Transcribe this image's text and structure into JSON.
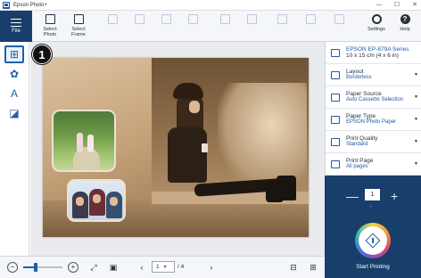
{
  "window": {
    "title": "Epson Photo+",
    "controls": [
      "—",
      "☐",
      "✕"
    ]
  },
  "toolbar": {
    "file_label": "File",
    "buttons": [
      {
        "label": "Select\nPhoto",
        "icon": "select-photo-icon",
        "enabled": true
      },
      {
        "label": "Select\nFrame",
        "icon": "select-frame-icon",
        "enabled": true
      },
      {
        "label": "",
        "icon": "crop-icon",
        "enabled": false
      },
      {
        "label": "",
        "icon": "fit-icon",
        "enabled": false
      },
      {
        "label": "",
        "icon": "rotate-icon",
        "enabled": false
      },
      {
        "label": "",
        "icon": "flip-icon",
        "enabled": false
      },
      {
        "label": "",
        "icon": "copy-icon",
        "enabled": false
      },
      {
        "label": "",
        "icon": "paste-icon",
        "enabled": false
      },
      {
        "label": "",
        "icon": "layer-front-icon",
        "enabled": false
      },
      {
        "label": "",
        "icon": "layer-back-icon",
        "enabled": false
      },
      {
        "label": "",
        "icon": "delete-icon",
        "enabled": false
      }
    ],
    "settings_label": "Settings",
    "help_label": "Help"
  },
  "callout": {
    "number": "1"
  },
  "left_tools": [
    {
      "name": "add-image-tool",
      "glyph": "⊞"
    },
    {
      "name": "stamp-tool",
      "glyph": "✿"
    },
    {
      "name": "text-tool",
      "glyph": "A"
    },
    {
      "name": "background-tool",
      "glyph": "◪"
    }
  ],
  "settings": {
    "printer": {
      "name": "EPSON EP-879A Series",
      "paper_size": "10 x 15 cm (4 x 6 in)"
    },
    "layout": {
      "label": "Layout",
      "value": "Borderless"
    },
    "paper_source": {
      "label": "Paper Source",
      "value": "Auto Cassette Selection"
    },
    "paper_type": {
      "label": "Paper Type",
      "value": "EPSON Photo Paper"
    },
    "print_quality": {
      "label": "Print Quality",
      "value": "Standard"
    },
    "print_page": {
      "label": "Print Page",
      "value": "All pages"
    }
  },
  "print": {
    "copies": "1",
    "copies_hint": "-",
    "minus": "—",
    "plus": "+",
    "start_label": "Start Printing"
  },
  "pager": {
    "current": "1",
    "total": "/ 4"
  },
  "colors": {
    "navy": "#183f6b",
    "accent_blue": "#1e5aa8",
    "toolbar_bg": "#f4f6f9",
    "canvas_bg": "#e9ebee",
    "sepia": "#c9a77e"
  },
  "zoom": {
    "level": 0.32
  }
}
